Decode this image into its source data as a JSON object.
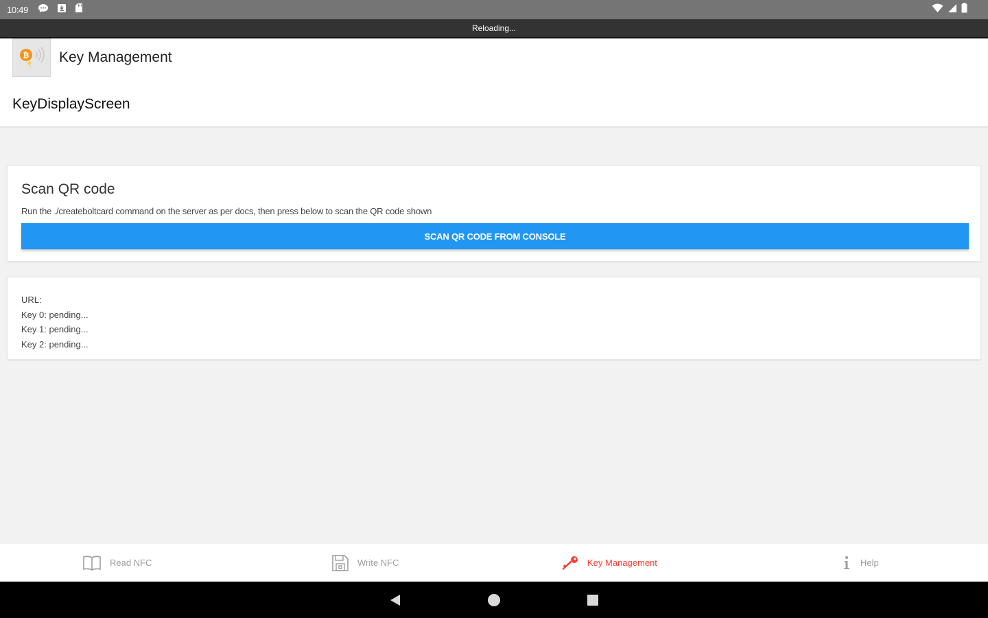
{
  "status_bar": {
    "time": "10:49",
    "left_icons": [
      "chat-icon",
      "download-box-icon",
      "sd-card-icon"
    ],
    "right_icons": [
      "wifi-icon",
      "signal-icon",
      "battery-icon"
    ]
  },
  "reload_bar": {
    "text": "Reloading..."
  },
  "header": {
    "app_title": "Key Management",
    "screen_title": "KeyDisplayScreen"
  },
  "scan_card": {
    "title": "Scan QR code",
    "description": "Run the ./createboltcard command on the server as per docs, then press below to scan the QR code shown",
    "button_label": "SCAN QR CODE FROM CONSOLE"
  },
  "keys_card": {
    "lines": [
      "URL:",
      "Key 0: pending...",
      "Key 1: pending...",
      "Key 2: pending..."
    ]
  },
  "bottom_nav": {
    "items": [
      {
        "label": "Read NFC",
        "icon": "book-icon",
        "active": false
      },
      {
        "label": "Write NFC",
        "icon": "save-icon",
        "active": false
      },
      {
        "label": "Key Management",
        "icon": "key-icon",
        "active": true
      },
      {
        "label": "Help",
        "icon": "info-icon",
        "active": false
      }
    ]
  },
  "colors": {
    "accent_blue": "#2196f3",
    "active_red": "#f44336",
    "inactive_gray": "#9e9e9e",
    "status_bar": "#757575"
  }
}
